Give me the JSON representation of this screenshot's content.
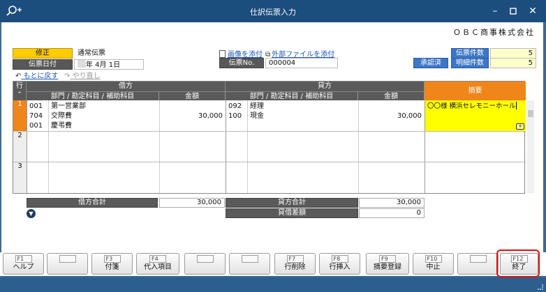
{
  "window": {
    "title": "仕訳伝票入力"
  },
  "company": "ＯＢＣ商事株式会社",
  "header": {
    "mode_label": "修正",
    "voucher_type": "通常伝票",
    "date_label": "伝票日付",
    "date_value": "年  4月  1日",
    "attach_image": "画像を添付",
    "attach_file": "外部ファイルを添付",
    "voucher_no_label": "伝票No.",
    "voucher_no_value": "000004",
    "approval_badge": "承認済",
    "voucher_count_label": "伝票件数",
    "voucher_count_value": "5",
    "detail_count_label": "明細件数",
    "detail_count_value": "5",
    "undo": "もとに戻す",
    "redo": "やり直し"
  },
  "grid": {
    "row_header": "行",
    "debit": "借方",
    "credit": "貸方",
    "account_header": "部門 / 勘定科目 / 補助科目",
    "amount_header": "金額",
    "summary_header": "摘要",
    "rows": [
      {
        "no": "1",
        "debit_codes": [
          "001",
          "704",
          "001"
        ],
        "debit_names": [
          "第一営業部",
          "交際費",
          "慶弔費"
        ],
        "debit_amount": "30,000",
        "credit_codes": [
          "092",
          "100"
        ],
        "credit_names": [
          "経理",
          "現金"
        ],
        "credit_amount": "30,000",
        "summary": "〇〇様  横浜セレモニーホール"
      },
      {
        "no": "2"
      },
      {
        "no": "3"
      }
    ]
  },
  "totals": {
    "debit_total_label": "借方合計",
    "debit_total_value": "30,000",
    "credit_total_label": "貸方合計",
    "credit_total_value": "30,000",
    "difference_label": "貸借差額",
    "difference_value": "0"
  },
  "fkeys": [
    {
      "key": "F1",
      "label": "ヘルプ"
    },
    {
      "key": "F2",
      "label": ""
    },
    {
      "key": "F3",
      "label": "付箋"
    },
    {
      "key": "F4",
      "label": "代入項目"
    },
    {
      "key": "F5",
      "label": ""
    },
    {
      "key": "F6",
      "label": ""
    },
    {
      "key": "F7",
      "label": "行削除"
    },
    {
      "key": "F8",
      "label": "行挿入"
    },
    {
      "key": "F9",
      "label": "摘要登録"
    },
    {
      "key": "F10",
      "label": "中止"
    },
    {
      "key": "F11",
      "label": ""
    },
    {
      "key": "F12",
      "label": "終了"
    }
  ],
  "colors": {
    "titlebar": "#1b4d7d",
    "mode": "#ffcc00",
    "summary_header": "#f08519",
    "selected_row": "#ffff00",
    "highlight": "#e01010"
  }
}
